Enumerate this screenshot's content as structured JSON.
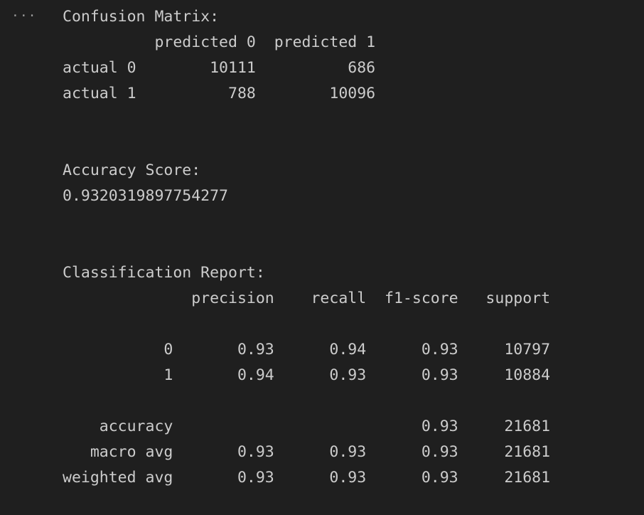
{
  "cell": {
    "more_actions_label": "···"
  },
  "output": {
    "lines": [
      "Confusion Matrix:",
      "          predicted 0  predicted 1",
      "actual 0        10111          686",
      "actual 1          788        10096",
      "",
      "",
      "Accuracy Score:",
      "0.9320319897754277",
      "",
      "",
      "Classification Report:",
      "              precision    recall  f1-score   support",
      "",
      "           0       0.93      0.94      0.93     10797",
      "           1       0.94      0.93      0.93     10884",
      "",
      "    accuracy                           0.93     21681",
      "   macro avg       0.93      0.93      0.93     21681",
      "weighted avg       0.93      0.93      0.93     21681"
    ]
  }
}
